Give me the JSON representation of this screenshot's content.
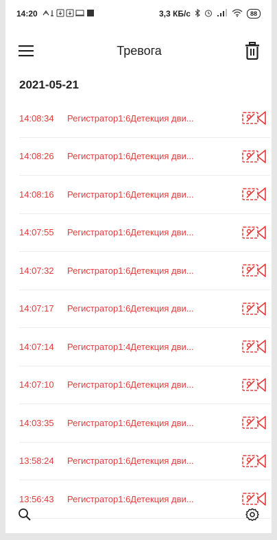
{
  "status_bar": {
    "time": "14:20",
    "left_icons": [
      "notification-icons"
    ],
    "network_speed": "3,3 КБ/с",
    "battery": "88"
  },
  "app_bar": {
    "title": "Тревога",
    "menu_icon": "menu-icon",
    "delete_icon": "trash-icon"
  },
  "date": "2021-05-21",
  "alarms": [
    {
      "time": "14:08:34",
      "text": "Регистратор1:6Детекция дви..."
    },
    {
      "time": "14:08:26",
      "text": "Регистратор1:6Детекция дви..."
    },
    {
      "time": "14:08:16",
      "text": "Регистратор1:6Детекция дви..."
    },
    {
      "time": "14:07:55",
      "text": "Регистратор1:6Детекция дви..."
    },
    {
      "time": "14:07:32",
      "text": "Регистратор1:6Детекция дви..."
    },
    {
      "time": "14:07:17",
      "text": "Регистратор1:6Детекция дви..."
    },
    {
      "time": "14:07:14",
      "text": "Регистратор1:4Детекция дви..."
    },
    {
      "time": "14:07:10",
      "text": "Регистратор1:6Детекция дви..."
    },
    {
      "time": "14:03:35",
      "text": "Регистратор1:6Детекция дви..."
    },
    {
      "time": "13:58:24",
      "text": "Регистратор1:6Детекция дви..."
    },
    {
      "time": "13:56:43",
      "text": "Регистратор1:6Детекция дви..."
    }
  ],
  "bottom_bar": {
    "left_icon": "search-icon",
    "right_icon": "settings-icon"
  },
  "colors": {
    "alarm": "#e23b3b",
    "text": "#222222"
  }
}
